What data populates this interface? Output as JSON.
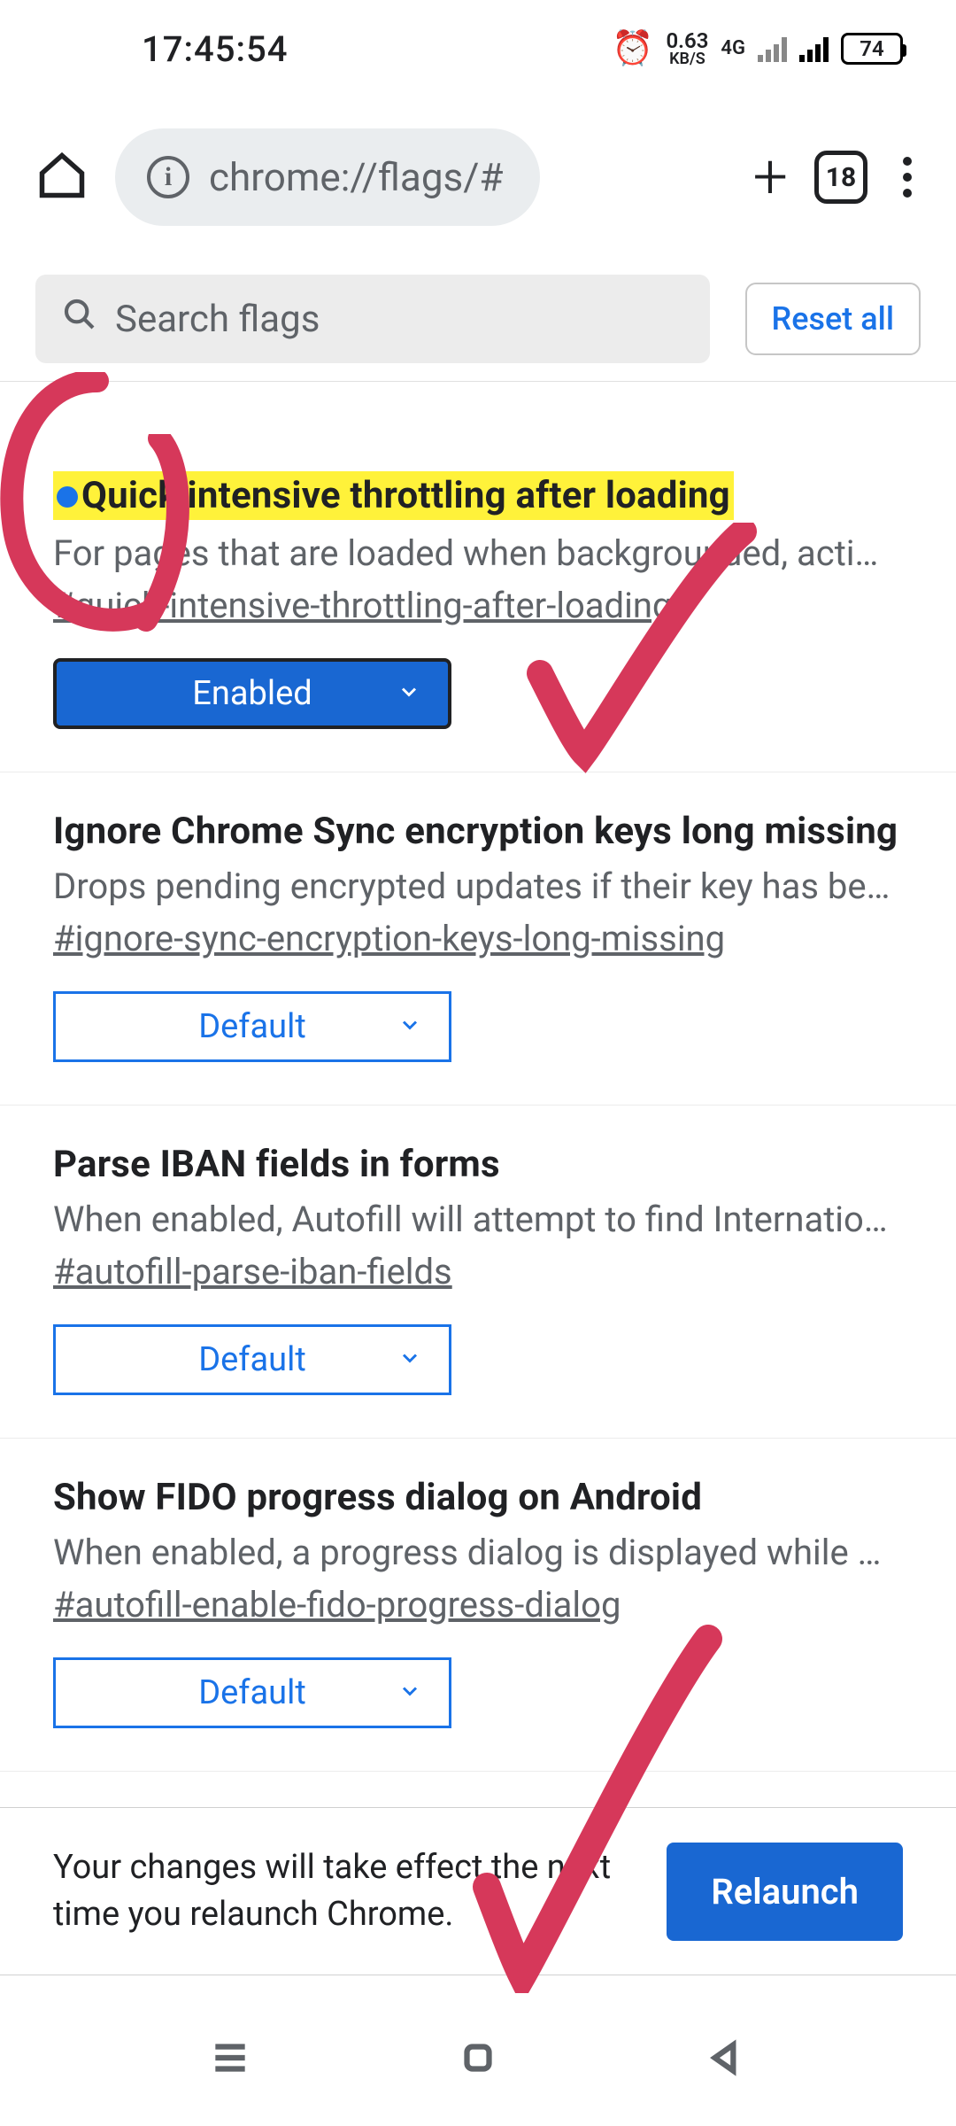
{
  "status": {
    "time": "17:45:54",
    "net_speed_value": "0.63",
    "net_speed_unit": "KB/S",
    "net_type": "4G",
    "battery": "74"
  },
  "chrome": {
    "url": "chrome://flags/#",
    "tab_count": "18"
  },
  "search": {
    "placeholder": "Search flags",
    "reset_label": "Reset all"
  },
  "flags": [
    {
      "title": "Quick intensive throttling after loading",
      "desc": "For pages that are loaded when backgrounded, acti…",
      "hash": "#quick-intensive-throttling-after-loading",
      "select": "Enabled",
      "modified": true
    },
    {
      "title": "Ignore Chrome Sync encryption keys long missing",
      "desc": "Drops pending encrypted updates if their key has be…",
      "hash": "#ignore-sync-encryption-keys-long-missing",
      "select": "Default",
      "modified": false
    },
    {
      "title": "Parse IBAN fields in forms",
      "desc": "When enabled, Autofill will attempt to find Internatio…",
      "hash": "#autofill-parse-iban-fields",
      "select": "Default",
      "modified": false
    },
    {
      "title": "Show FIDO progress dialog on Android",
      "desc": "When enabled, a progress dialog is displayed while …",
      "hash": "#autofill-enable-fido-progress-dialog",
      "select": "Default",
      "modified": false
    }
  ],
  "relaunch": {
    "message": "Your changes will take effect the next time you relaunch Chrome.",
    "button": "Relaunch"
  }
}
